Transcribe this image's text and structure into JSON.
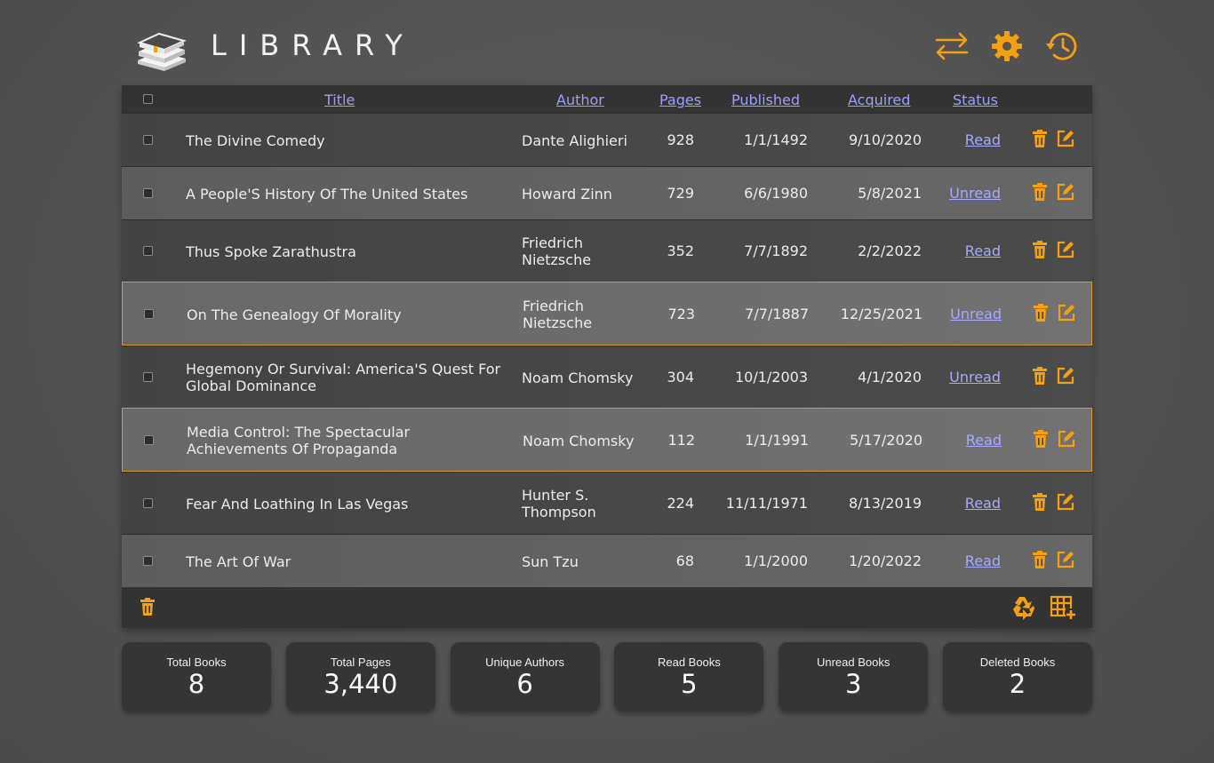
{
  "app": {
    "title": "LIBRARY"
  },
  "header_icons": [
    "swap-icon",
    "gear-icon",
    "history-icon"
  ],
  "colors": {
    "accent": "#f5a10e",
    "link": "#9e9eff",
    "selected_border": "#e09a1a"
  },
  "table": {
    "columns": {
      "title": "Title",
      "author": "Author",
      "pages": "Pages",
      "published": "Published",
      "acquired": "Acquired",
      "status": "Status"
    },
    "rows": [
      {
        "title": "The Divine Comedy",
        "author": "Dante Alighieri",
        "pages": "928",
        "published": "1/1/1492",
        "acquired": "9/10/2020",
        "status": "Read"
      },
      {
        "title": "A People'S History Of The United States",
        "author": "Howard Zinn",
        "pages": "729",
        "published": "6/6/1980",
        "acquired": "5/8/2021",
        "status": "Unread"
      },
      {
        "title": "Thus Spoke Zarathustra",
        "author": "Friedrich Nietzsche",
        "pages": "352",
        "published": "7/7/1892",
        "acquired": "2/2/2022",
        "status": "Read"
      },
      {
        "title": "On The Genealogy Of Morality",
        "author": "Friedrich Nietzsche",
        "pages": "723",
        "published": "7/7/1887",
        "acquired": "12/25/2021",
        "status": "Unread"
      },
      {
        "title": "Hegemony Or Survival: America'S Quest For Global Dominance",
        "author": "Noam Chomsky",
        "pages": "304",
        "published": "10/1/2003",
        "acquired": "4/1/2020",
        "status": "Unread"
      },
      {
        "title": "Media Control: The Spectacular Achievements Of Propaganda",
        "author": "Noam Chomsky",
        "pages": "112",
        "published": "1/1/1991",
        "acquired": "5/17/2020",
        "status": "Read"
      },
      {
        "title": "Fear And Loathing In Las Vegas",
        "author": "Hunter S. Thompson",
        "pages": "224",
        "published": "11/11/1971",
        "acquired": "8/13/2019",
        "status": "Read"
      },
      {
        "title": "The Art Of War",
        "author": "Sun Tzu",
        "pages": "68",
        "published": "1/1/2000",
        "acquired": "1/20/2022",
        "status": "Read"
      }
    ],
    "row_actions": [
      "trash-icon",
      "edit-icon"
    ],
    "footer_icons": [
      "trash-icon",
      "recycle-icon",
      "add-table-icon"
    ]
  },
  "stats": [
    {
      "label": "Total Books",
      "value": "8"
    },
    {
      "label": "Total Pages",
      "value": "3,440"
    },
    {
      "label": "Unique Authors",
      "value": "6"
    },
    {
      "label": "Read Books",
      "value": "5"
    },
    {
      "label": "Unread Books",
      "value": "3"
    },
    {
      "label": "Deleted Books",
      "value": "2"
    }
  ]
}
